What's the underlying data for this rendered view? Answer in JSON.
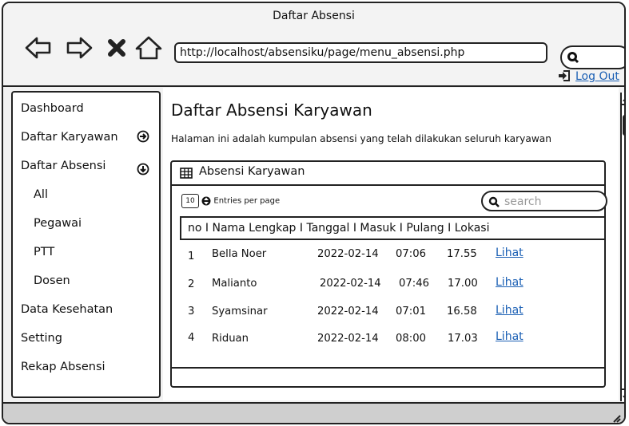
{
  "window": {
    "title": "Daftar Absensi"
  },
  "browser": {
    "url": "http://localhost/absensiku/page/menu_absensi.php",
    "logout_label": "Log Out",
    "icons": [
      "back-arrow-icon",
      "forward-arrow-icon",
      "close-x-icon",
      "home-icon",
      "search-icon",
      "logout-icon"
    ]
  },
  "sidebar": {
    "items": [
      {
        "label": "Dashboard"
      },
      {
        "label": "Daftar Karyawan",
        "icon": "arrow-right-circle-icon"
      },
      {
        "label": "Daftar Absensi",
        "icon": "arrow-down-circle-icon",
        "expanded": true
      },
      {
        "label": "All"
      },
      {
        "label": "Pegawai"
      },
      {
        "label": "PTT"
      },
      {
        "label": "Dosen"
      },
      {
        "label": "Data Kesehatan"
      },
      {
        "label": "Setting"
      },
      {
        "label": "Rekap Absensi"
      }
    ]
  },
  "main": {
    "title": "Daftar Absensi Karyawan",
    "description": "Halaman ini adalah kumpulan absensi yang telah dilakukan seluruh karyawan",
    "panel": {
      "title": "Absensi Karyawan",
      "entries_value": "10",
      "entries_label": "Entries per page",
      "search_placeholder": "search",
      "header": "no I Nama Lengkap  I  Tanggal  I Masuk I Pulang I Lokasi",
      "rows": [
        {
          "no": "1",
          "nama": "Bella Noer",
          "tanggal": "2022-02-14",
          "masuk": "07:06",
          "pulang": "17.55",
          "lokasi": "Lihat"
        },
        {
          "no": "2",
          "nama": "Malianto",
          "tanggal": "2022-02-14",
          "masuk": "07:46",
          "pulang": "17.00",
          "lokasi": "Lihat"
        },
        {
          "no": "3",
          "nama": "Syamsinar",
          "tanggal": "2022-02-14",
          "masuk": "07:01",
          "pulang": "16.58",
          "lokasi": "Lihat"
        },
        {
          "no": "4",
          "nama": "Riduan",
          "tanggal": "2022-02-14",
          "masuk": "08:00",
          "pulang": "17.03",
          "lokasi": "Lihat"
        }
      ]
    }
  },
  "colors": {
    "link": "#1a5fb4",
    "border": "#222222",
    "chrome": "#f3f3f3",
    "status_bar": "#cfcfcf"
  }
}
